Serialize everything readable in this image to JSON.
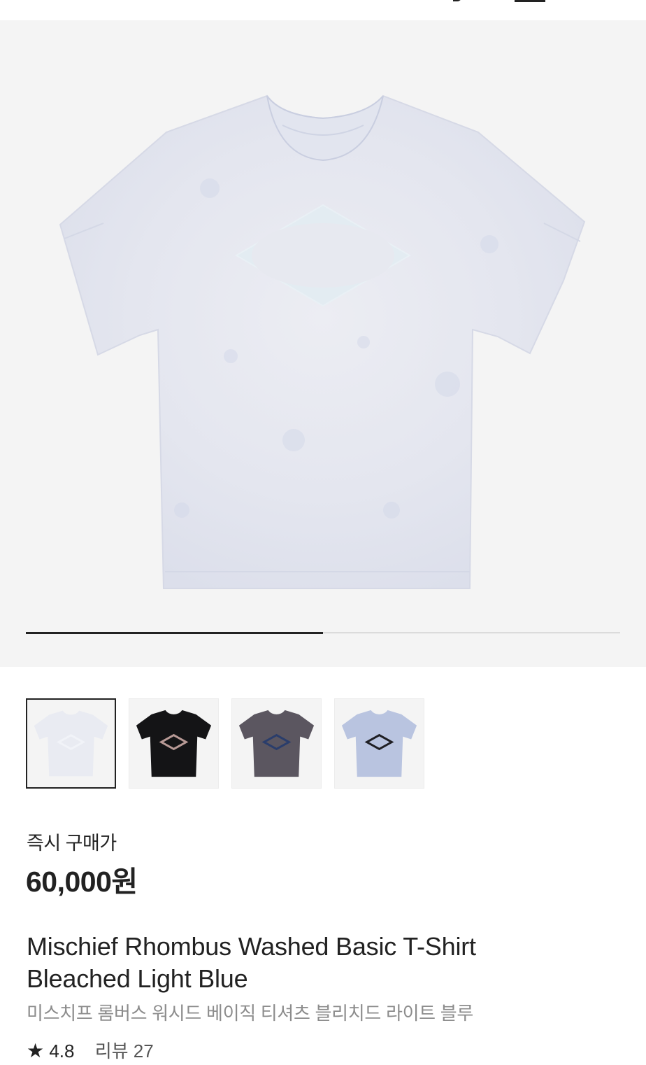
{
  "hero": {
    "slider_progress": 0.5,
    "image_alt": "Bleached Light Blue T-Shirt"
  },
  "thumbnails": [
    {
      "color_name": "Bleached Light Blue",
      "shirt_color": "#e9ebf2",
      "logo_color": "#f1f3f8",
      "selected": true
    },
    {
      "color_name": "Black",
      "shirt_color": "#141416",
      "logo_color": "#b89a96",
      "selected": false
    },
    {
      "color_name": "Charcoal",
      "shirt_color": "#5b5660",
      "logo_color": "#2a3d6b",
      "selected": false
    },
    {
      "color_name": "Light Blue",
      "shirt_color": "#b9c4e0",
      "logo_color": "#1f1f24",
      "selected": false
    }
  ],
  "price": {
    "label": "즉시 구매가",
    "value": "60,000원"
  },
  "product": {
    "title_en_line1": "Mischief Rhombus Washed Basic T-Shirt",
    "title_en_line2": "Bleached Light Blue",
    "title_ko": "미스치프 롬버스 워시드 베이직 티셔츠 블리치드 라이트 블루"
  },
  "rating": {
    "star_icon": "★",
    "score": "4.8",
    "review_label": "리뷰 27"
  },
  "colors": {
    "text": "#222222",
    "subtext": "#8c8c8c",
    "image_bg": "#f4f4f4",
    "selected_border": "#222222"
  }
}
